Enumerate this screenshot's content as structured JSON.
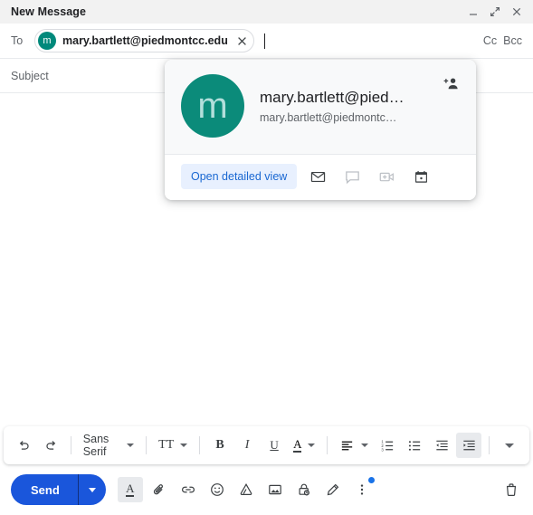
{
  "window": {
    "title": "New Message",
    "controls": [
      {
        "name": "minimize",
        "icon": "minimize-icon"
      },
      {
        "name": "expand",
        "icon": "expand-icon"
      },
      {
        "name": "close",
        "icon": "close-icon"
      }
    ]
  },
  "recipients": {
    "label": "To",
    "chip": {
      "avatar_initial": "m",
      "avatar_color": "#00897b",
      "email": "mary.bartlett@piedmontcc.edu",
      "remove_icon": "close-icon"
    },
    "cc_label": "Cc",
    "bcc_label": "Bcc"
  },
  "subject": {
    "placeholder": "Subject",
    "value": ""
  },
  "body": {
    "value": "",
    "placeholder": ""
  },
  "contact_card": {
    "avatar_initial": "m",
    "avatar_color": "#0b8b7a",
    "name": "mary.bartlett@pied…",
    "email": "mary.bartlett@piedmontc…",
    "add_contact_icon": "add-person-icon",
    "detail_button": "Open detailed view",
    "detail_button_color": "#1967d2",
    "detail_button_bg": "#e8f0fe",
    "actions": [
      {
        "name": "email",
        "icon": "envelope-icon",
        "disabled": false
      },
      {
        "name": "chat",
        "icon": "chat-bubble-icon",
        "disabled": true
      },
      {
        "name": "video-call",
        "icon": "video-call-add-icon",
        "disabled": false
      },
      {
        "name": "calendar",
        "icon": "calendar-icon",
        "disabled": false
      }
    ]
  },
  "format_toolbar": {
    "undo_icon": "undo-icon",
    "redo_icon": "redo-icon",
    "font_name": "Sans Serif",
    "font_size_label": "TT",
    "bold_label": "B",
    "italic_label": "I",
    "underline_label": "U",
    "text_color_label": "A",
    "align_icon": "align-left-icon",
    "numbered_list_icon": "numbered-list-icon",
    "bulleted_list_icon": "bulleted-list-icon",
    "outdent_icon": "outdent-icon",
    "indent_icon": "indent-icon",
    "more_icon": "chevron-down-icon"
  },
  "action_bar": {
    "send_label": "Send",
    "send_color": "#1a56db",
    "send_options_icon": "chevron-down-icon",
    "icons": [
      {
        "name": "formatting-options",
        "icon": "text-format-icon",
        "active": true
      },
      {
        "name": "attach-file",
        "icon": "paperclip-icon",
        "active": false
      },
      {
        "name": "insert-link",
        "icon": "link-icon",
        "active": false
      },
      {
        "name": "insert-emoji",
        "icon": "emoji-icon",
        "active": false
      },
      {
        "name": "insert-drive-file",
        "icon": "drive-icon",
        "active": false
      },
      {
        "name": "insert-photo",
        "icon": "image-icon",
        "active": false
      },
      {
        "name": "confidential-mode",
        "icon": "lock-clock-icon",
        "active": false
      },
      {
        "name": "insert-signature",
        "icon": "pen-icon",
        "active": false
      },
      {
        "name": "more-options",
        "icon": "more-vertical-icon",
        "active": false,
        "badge": true
      }
    ],
    "discard_icon": "trash-icon"
  }
}
